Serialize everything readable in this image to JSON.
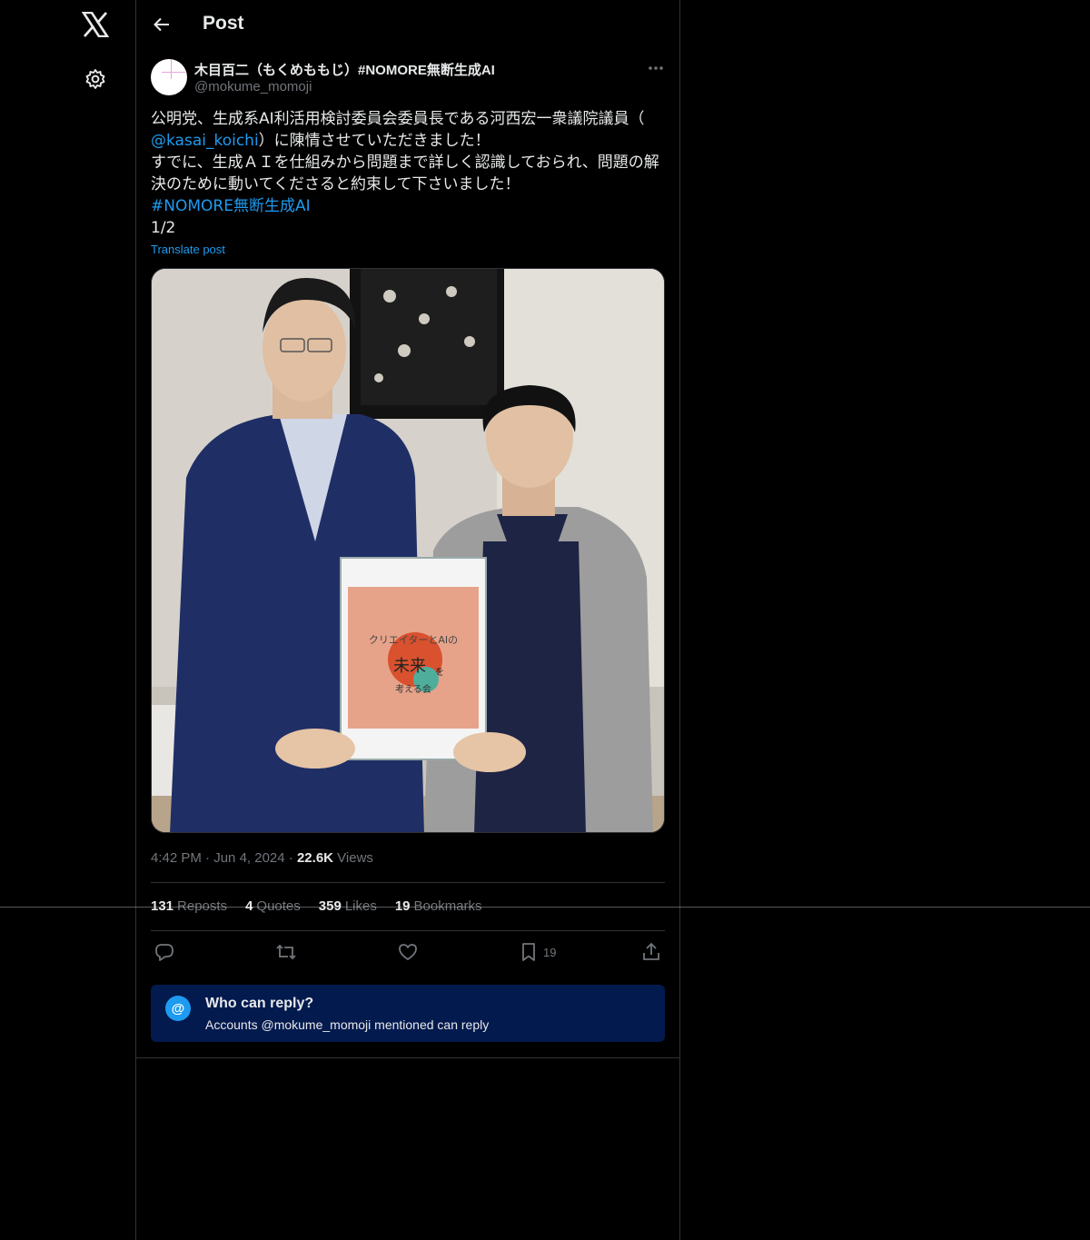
{
  "nav": {
    "logo_icon": "x-logo-icon",
    "settings_icon": "gear-icon"
  },
  "header": {
    "back_icon": "arrow-left-icon",
    "title": "Post"
  },
  "post": {
    "author_name": "木目百二（もくめももじ）#NOMORE無断生成AI",
    "author_handle": "@mokume_momoji",
    "more_icon": "more-horizontal-icon",
    "text_line1": "公明党、生成系AI利活用検討委員会委員長である河西宏一衆議院議員（",
    "mention": "@kasai_koichi",
    "text_line2_rest": "）に陳情させていただきました！",
    "text_line3": "すでに、生成ＡＩを仕組みから問題まで詳しく認識しておられ、問題の解",
    "text_line4": "決のために動いてくださると約束して下さいました！",
    "hashtag": "#NOMORE無断生成AI",
    "page_count": "1/2",
    "translate_label": "Translate post",
    "photo_sign_line1": "クリエイターとAIの",
    "photo_sign_line2": "未来",
    "photo_sign_line2b": "を",
    "photo_sign_line3": "考える会",
    "time": "4:42 PM",
    "date": "Jun 4, 2024",
    "views_count": "22.6K",
    "views_label": "Views",
    "separator": "·"
  },
  "stats": {
    "reposts_count": "131",
    "reposts_label": "Reposts",
    "quotes_count": "4",
    "quotes_label": "Quotes",
    "likes_count": "359",
    "likes_label": "Likes",
    "bookmarks_count": "19",
    "bookmarks_label": "Bookmarks"
  },
  "actions": {
    "reply_icon": "reply-icon",
    "repost_icon": "repost-icon",
    "like_icon": "heart-icon",
    "bookmark_icon": "bookmark-icon",
    "bookmark_count": "19",
    "share_icon": "share-icon"
  },
  "who_can_reply": {
    "icon_glyph": "@",
    "title": "Who can reply?",
    "subtitle": "Accounts @mokume_momoji mentioned can reply"
  },
  "colors": {
    "background": "#000000",
    "border": "#2f3336",
    "accent": "#1d9bf0",
    "muted": "#71767b",
    "text": "#e7e9ea",
    "reply_box": "#031a4e"
  }
}
